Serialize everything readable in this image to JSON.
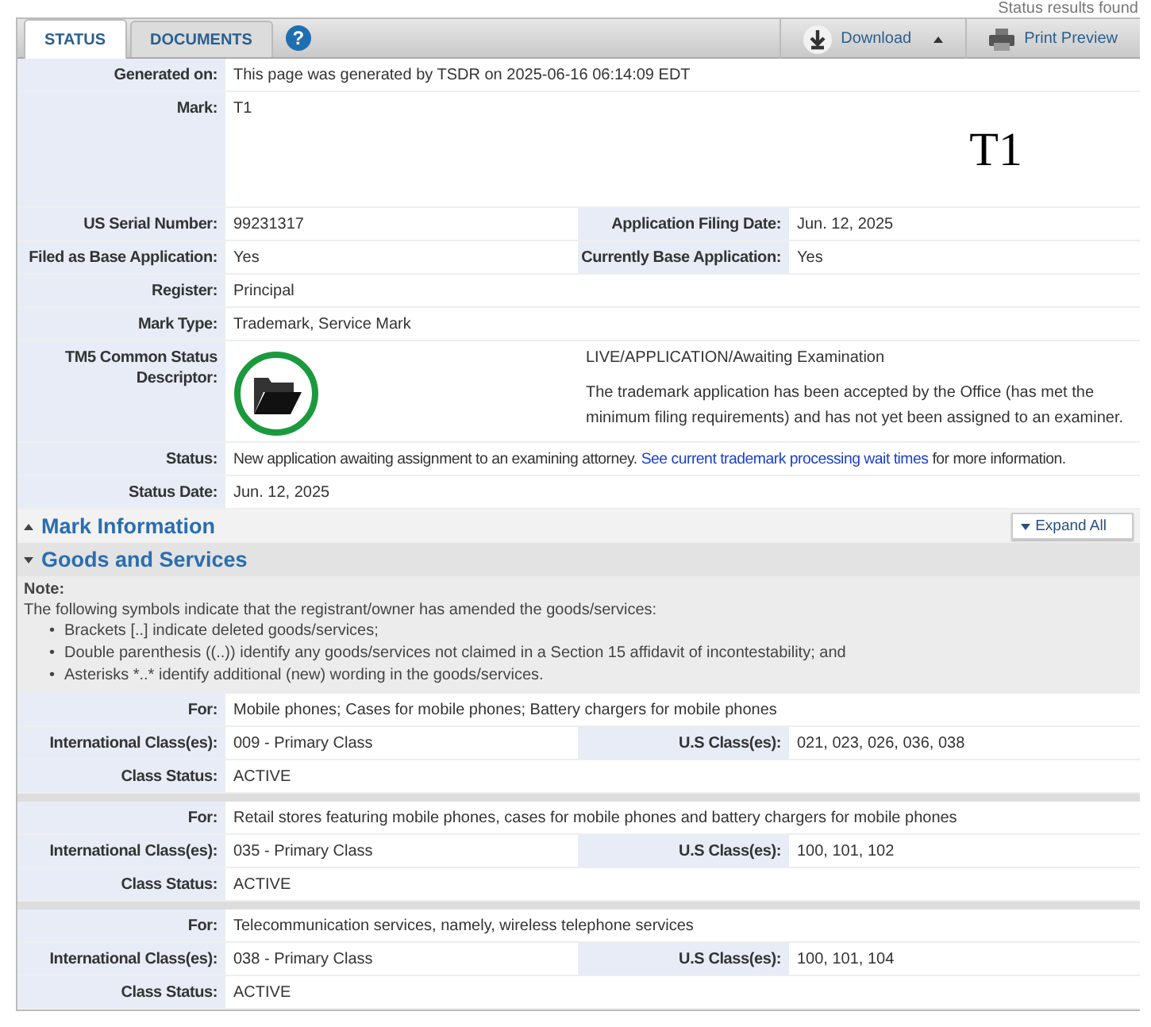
{
  "top_note": "Status results found",
  "tabs": [
    {
      "label": "STATUS",
      "selected": true
    },
    {
      "label": "DOCUMENTS",
      "selected": false
    }
  ],
  "help": "?",
  "toolbar": {
    "download": "Download",
    "print": "Print Preview"
  },
  "status_rows": [
    {
      "kind": "text",
      "label": "Generated on:",
      "value": "This page was generated by TSDR on 2025-06-16 06:14:09 EDT"
    },
    {
      "kind": "mark",
      "label": "Mark:",
      "value": "T1",
      "image_text": "T1"
    },
    {
      "kind": "pair",
      "label": "US Serial Number:",
      "value": "99231317",
      "label_2": "Application Filing Date:",
      "value_2": "Jun. 12, 2025"
    },
    {
      "kind": "pair",
      "label": "Filed as Base Application:",
      "value": "Yes",
      "label_2": "Currently Base Application:",
      "value_2": "Yes"
    },
    {
      "kind": "text",
      "label": "Register:",
      "value": "Principal"
    },
    {
      "kind": "text",
      "label": "Mark Type:",
      "value": "Trademark, Service Mark"
    },
    {
      "kind": "descriptor",
      "label": "TM5 Common Status Descriptor:",
      "title": "LIVE/APPLICATION/Awaiting Examination",
      "description": "The trademark application has been accepted by the Office (has met the minimum filing requirements) and has not yet been assigned to an examiner."
    },
    {
      "kind": "link",
      "label": "Status:",
      "value": "New application awaiting assignment to an examining attorney.",
      "link": "See current trademark processing wait times",
      "value_after": "for more information."
    },
    {
      "kind": "text",
      "label": "Status Date:",
      "value": "Jun. 12, 2025"
    }
  ],
  "sections": [
    {
      "title": "Mark Information",
      "expanded": false
    },
    {
      "title": "Goods and Services",
      "expanded": true
    }
  ],
  "expand_all": "Expand All",
  "note": {
    "heading": "Note:",
    "marker": "•",
    "intro": "The following symbols indicate that the registrant/owner has amended the goods/services:",
    "bullets": [
      "Brackets [..] indicate deleted goods/services;",
      "Double parenthesis ((..)) identify any goods/services not claimed in a Section 15 affidavit of incontestability; and",
      "Asterisks *..* identify additional (new) wording in the goods/services."
    ]
  },
  "goods": [
    {
      "for_label": "For:",
      "for": "Mobile phones; Cases for mobile phones; Battery chargers for mobile phones",
      "intl_label": "International Class(es):",
      "intl": "009 - Primary Class",
      "us_label": "U.S Class(es):",
      "us": "021, 023, 026, 036, 038",
      "status_label": "Class Status:",
      "status": "ACTIVE"
    },
    {
      "for_label": "For:",
      "for": "Retail stores featuring mobile phones, cases for mobile phones and battery chargers for mobile phones",
      "intl_label": "International Class(es):",
      "intl": "035 - Primary Class",
      "us_label": "U.S Class(es):",
      "us": "100, 101, 102",
      "status_label": "Class Status:",
      "status": "ACTIVE"
    },
    {
      "for_label": "For:",
      "for": "Telecommunication services, namely, wireless telephone services",
      "intl_label": "International Class(es):",
      "intl": "038 - Primary Class",
      "us_label": "U.S Class(es):",
      "us": "100, 101, 104",
      "status_label": "Class Status:",
      "status": "ACTIVE"
    }
  ]
}
